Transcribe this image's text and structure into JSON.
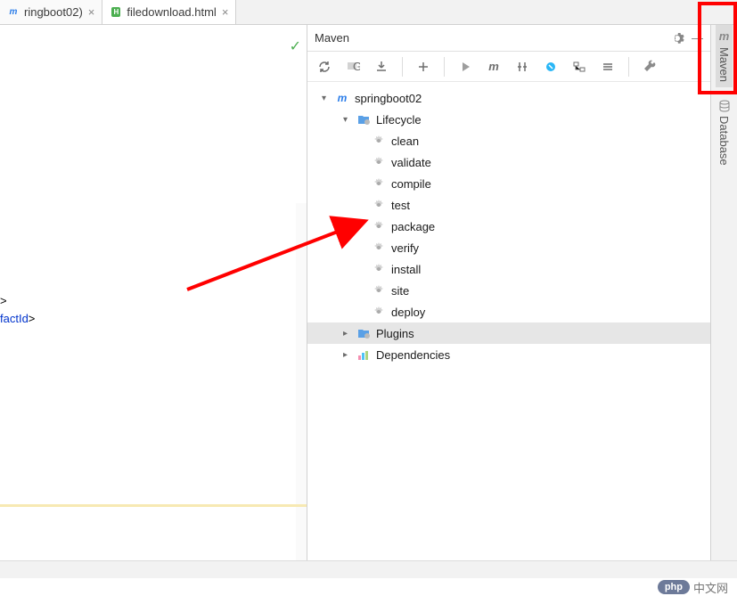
{
  "tabs": [
    {
      "label": "ringboot02)",
      "icon": "xml"
    },
    {
      "label": "filedownload.html",
      "icon": "html"
    }
  ],
  "editor": {
    "check_ok": "✓",
    "line1": ">",
    "line2_tag": "factId",
    "line2_close": ">"
  },
  "maven": {
    "panel_title": "Maven",
    "project": "springboot02",
    "lifecycle_label": "Lifecycle",
    "lifecycle_goals": [
      "clean",
      "validate",
      "compile",
      "test",
      "package",
      "verify",
      "install",
      "site",
      "deploy"
    ],
    "plugins_label": "Plugins",
    "dependencies_label": "Dependencies"
  },
  "rightbar": {
    "maven_label": "Maven",
    "database_label": "Database"
  },
  "footer": {
    "badge": "php",
    "text": "中文网"
  }
}
